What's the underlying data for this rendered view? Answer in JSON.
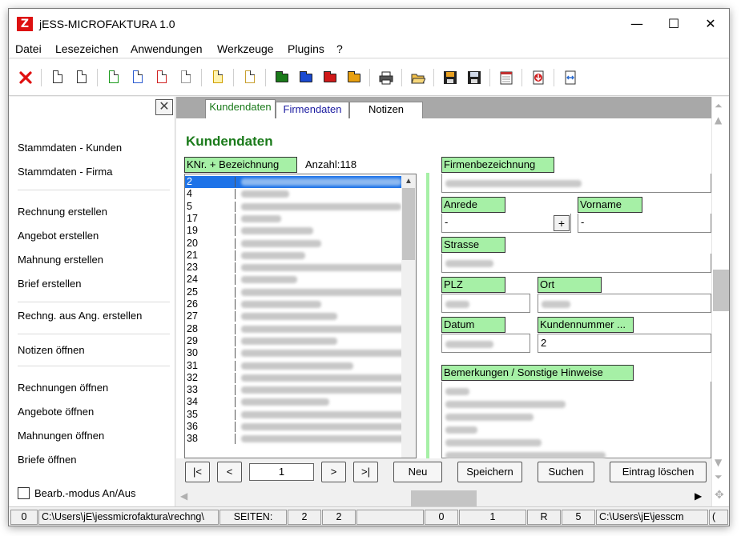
{
  "window": {
    "title": "jESS-MICROFAKTURA 1.0",
    "minimize": "—",
    "maximize": "☐",
    "close": "✕"
  },
  "menu": [
    "Datei",
    "Lesezeichen",
    "Anwendungen",
    "Werkzeuge",
    "Plugins",
    "?"
  ],
  "toolbar": {
    "icons": [
      "delete-icon",
      "new-doc-icon",
      "new-doc-icon",
      "green-doc-icon",
      "blue-doc-icon",
      "red-doc-icon",
      "gray-doc-icon",
      "yellow-doc-icon",
      "blank-doc-icon",
      "green-folder-icon",
      "blue-folder-icon",
      "red-folder-icon",
      "yellow-folder-icon",
      "printer-icon",
      "open-folder-icon",
      "save-icon",
      "save-as-icon",
      "calendar-icon",
      "import-icon",
      "export-icon"
    ]
  },
  "sidebar": {
    "close": "✕",
    "items": [
      "Stammdaten - Kunden",
      "Stammdaten - Firma",
      "Rechnung erstellen",
      "Angebot erstellen",
      "Mahnung erstellen",
      "Brief erstellen",
      "Rechng. aus Ang. erstellen",
      "Notizen öffnen",
      "Rechnungen öffnen",
      "Angebote öffnen",
      "Mahnungen öffnen",
      "Briefe öffnen"
    ],
    "edit_mode_label": "Bearb.-modus An/Aus",
    "edit_mode_checked": false
  },
  "tabs": [
    "Kundendaten",
    "Firmendaten",
    "Notizen"
  ],
  "active_tab": "Kundendaten",
  "heading": "Kundendaten",
  "list": {
    "header": "KNr. + Bezeichnung",
    "count_label": "Anzahl:118",
    "rows": [
      "2",
      "4",
      "5",
      "17",
      "19",
      "20",
      "21",
      "23",
      "24",
      "25",
      "26",
      "27",
      "28",
      "29",
      "30",
      "31",
      "32",
      "33",
      "34",
      "35",
      "36",
      "38"
    ],
    "selected_index": 0
  },
  "form": {
    "firmenbezeichnung_label": "Firmenbezeichnung",
    "anrede_label": "Anrede",
    "anrede_value": "-",
    "plus_button": "+",
    "vorname_label": "Vorname",
    "vorname_value": "-",
    "strasse_label": "Strasse",
    "plz_label": "PLZ",
    "ort_label": "Ort",
    "datum_label": "Datum",
    "kundennummer_label": "Kundennummer ...",
    "kundennummer_value": "2",
    "bemerkungen_label": "Bemerkungen / Sonstige Hinweise"
  },
  "nav": {
    "first": "|<",
    "prev": "<",
    "record": "1",
    "next": ">",
    "last": ">|",
    "neu": "Neu",
    "speichern": "Speichern",
    "suchen": "Suchen",
    "loeschen": "Eintrag löschen"
  },
  "status": [
    "0",
    "C:\\Users\\jE\\jessmicrofaktura\\rechng\\",
    "SEITEN:",
    "2",
    "2",
    "",
    "",
    "0",
    "1",
    "R",
    "5",
    "C:\\Users\\jE\\jesscm",
    "("
  ]
}
